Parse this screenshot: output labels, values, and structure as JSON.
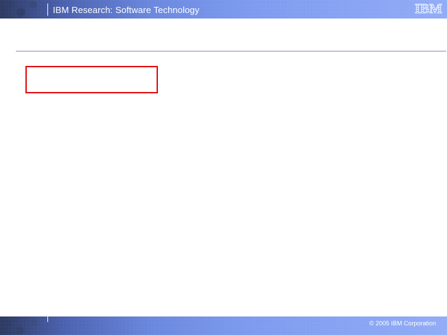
{
  "header": {
    "title": "IBM Research: Software Technology",
    "logo_text": "IBM",
    "band_color": "#6f8fea"
  },
  "body": {
    "rule_color": "#8a92b0",
    "placeholder_box_color": "#e01010"
  },
  "footer": {
    "copyright": "© 2005 IBM Corporation"
  }
}
